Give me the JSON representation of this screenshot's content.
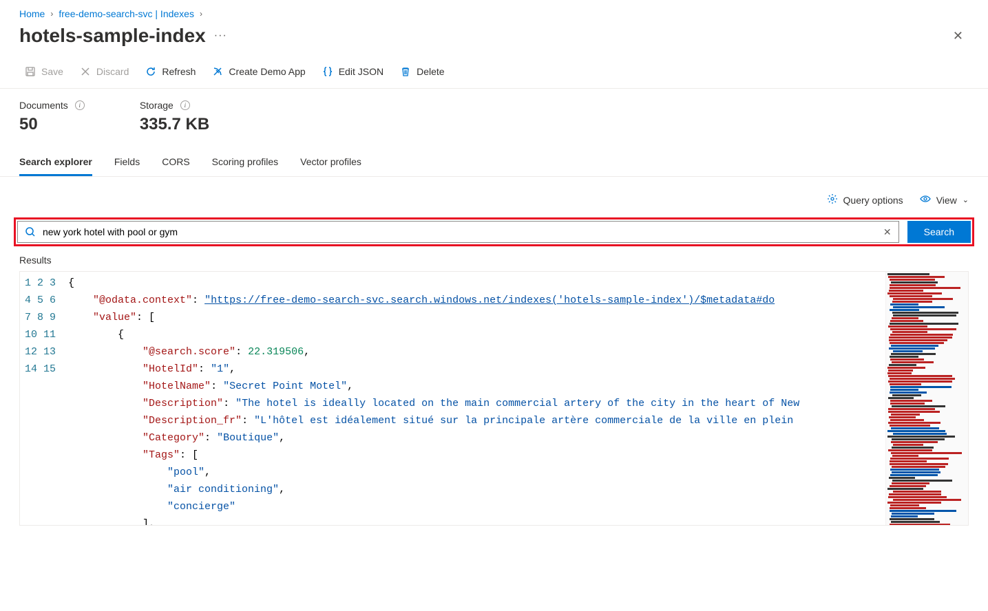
{
  "breadcrumb": {
    "home": "Home",
    "service": "free-demo-search-svc | Indexes"
  },
  "page": {
    "title": "hotels-sample-index"
  },
  "toolbar": {
    "save": "Save",
    "discard": "Discard",
    "refresh": "Refresh",
    "create_demo": "Create Demo App",
    "edit_json": "Edit JSON",
    "delete": "Delete"
  },
  "stats": {
    "documents_label": "Documents",
    "documents_value": "50",
    "storage_label": "Storage",
    "storage_value": "335.7 KB"
  },
  "tabs": {
    "search_explorer": "Search explorer",
    "fields": "Fields",
    "cors": "CORS",
    "scoring": "Scoring profiles",
    "vector": "Vector profiles"
  },
  "options": {
    "query_options": "Query options",
    "view": "View"
  },
  "search": {
    "value": "new york hotel with pool or gym",
    "button": "Search"
  },
  "results": {
    "label": "Results",
    "lines": [
      "1",
      "2",
      "3",
      "4",
      "5",
      "6",
      "7",
      "8",
      "9",
      "10",
      "11",
      "12",
      "13",
      "14",
      "15"
    ],
    "json": {
      "context_key": "\"@odata.context\"",
      "context_val": "\"https://free-demo-search-svc.search.windows.net/indexes('hotels-sample-index')/$metadata#do",
      "value_key": "\"value\"",
      "score_key": "\"@search.score\"",
      "score_val": "22.319506",
      "hotelid_key": "\"HotelId\"",
      "hotelid_val": "\"1\"",
      "hotelname_key": "\"HotelName\"",
      "hotelname_val": "\"Secret Point Motel\"",
      "desc_key": "\"Description\"",
      "desc_val": "\"The hotel is ideally located on the main commercial artery of the city in the heart of New",
      "descfr_key": "\"Description_fr\"",
      "descfr_val": "\"L'hôtel est idéalement situé sur la principale artère commerciale de la ville en plein",
      "category_key": "\"Category\"",
      "category_val": "\"Boutique\"",
      "tags_key": "\"Tags\"",
      "tag_pool": "\"pool\"",
      "tag_ac": "\"air conditioning\"",
      "tag_concierge": "\"concierge\""
    }
  }
}
